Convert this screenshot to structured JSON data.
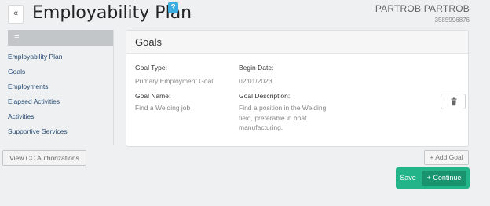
{
  "header": {
    "back_icon": "«",
    "title": "Employability Plan",
    "help_icon": "?",
    "user_name": "PARTROB PARTROB",
    "user_phone": "3585996876"
  },
  "sidebar": {
    "menu_icon": "≡",
    "items": [
      {
        "label": "Employability Plan"
      },
      {
        "label": "Goals"
      },
      {
        "label": "Employments"
      },
      {
        "label": "Elapsed Activities"
      },
      {
        "label": "Activities"
      },
      {
        "label": "Supportive Services"
      }
    ]
  },
  "view_cc_label": "View CC Authorizations",
  "goals": {
    "title": "Goals",
    "goal_type_label": "Goal Type:",
    "goal_type_value": "Primary Employment Goal",
    "begin_date_label": "Begin Date:",
    "begin_date_value": "02/01/2023",
    "goal_name_label": "Goal Name:",
    "goal_name_value": "Find a Welding job",
    "goal_desc_label": "Goal Description:",
    "goal_desc_lines": [
      "Find a position in the Welding",
      "field, preferable in boat",
      "manufacturing."
    ]
  },
  "add_goal_label": "+ Add Goal",
  "save_label": "Save",
  "continue_label": "+ Continue",
  "colors": {
    "accent": "#23b48a",
    "accent_dark": "#18936e",
    "link": "#274c73",
    "help": "#3aaee0"
  }
}
